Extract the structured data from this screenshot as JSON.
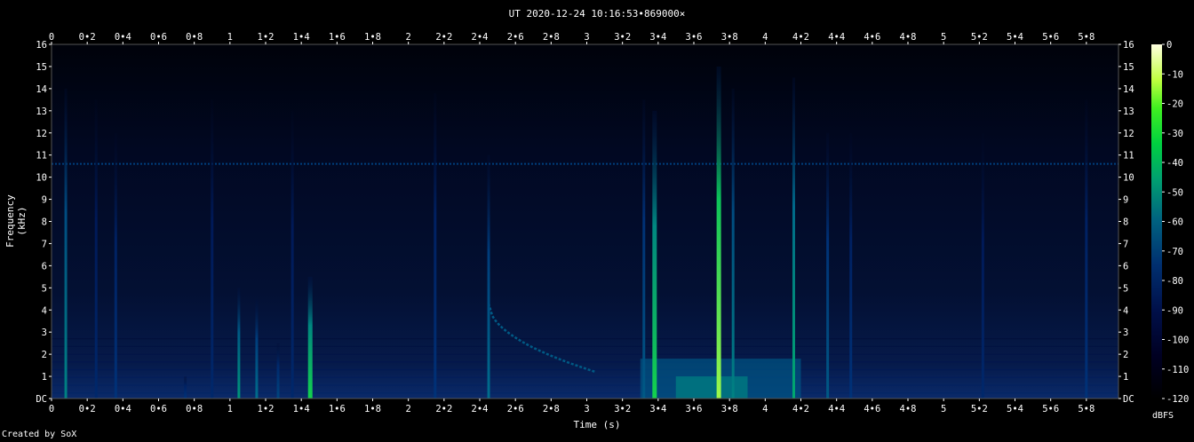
{
  "title": "UT 2020-12-24 10:16:53•869000×",
  "credit": "Created by SoX",
  "chart_data": {
    "type": "heatmap",
    "title": "UT 2020-12-24 10:16:53•869000×",
    "xlabel": "Time (s)",
    "ylabel": "Frequency (kHz)",
    "xlim": [
      0,
      5.98
    ],
    "ylim": [
      0,
      16
    ],
    "x_ticks": [
      "0",
      "0•2",
      "0•4",
      "0•6",
      "0•8",
      "1",
      "1•2",
      "1•4",
      "1•6",
      "1•8",
      "2",
      "2•2",
      "2•4",
      "2•6",
      "2•8",
      "3",
      "3•2",
      "3•4",
      "3•6",
      "3•8",
      "4",
      "4•2",
      "4•4",
      "4•6",
      "4•8",
      "5",
      "5•2",
      "5•4",
      "5•6",
      "5•8"
    ],
    "y_ticks": [
      "DC",
      "1",
      "2",
      "3",
      "4",
      "5",
      "6",
      "7",
      "8",
      "9",
      "10",
      "11",
      "12",
      "13",
      "14",
      "15",
      "16"
    ],
    "colorbar": {
      "label": "dBFS",
      "ticks": [
        "0",
        "-10",
        "-20",
        "-30",
        "-40",
        "-50",
        "-60",
        "-70",
        "-80",
        "-90",
        "-100",
        "-110",
        "-120"
      ],
      "range": [
        -120,
        0
      ]
    },
    "features": {
      "hum_line_khz": 10.6,
      "vertical_bursts": [
        {
          "t": 0.08,
          "top_khz": 14.0,
          "level": 0.55
        },
        {
          "t": 0.25,
          "top_khz": 13.5,
          "level": 0.3
        },
        {
          "t": 0.36,
          "top_khz": 12.0,
          "level": 0.35
        },
        {
          "t": 0.75,
          "top_khz": 1.0,
          "level": 0.35
        },
        {
          "t": 0.9,
          "top_khz": 13.5,
          "level": 0.3
        },
        {
          "t": 1.05,
          "top_khz": 5.0,
          "level": 0.6
        },
        {
          "t": 1.15,
          "top_khz": 4.5,
          "level": 0.5
        },
        {
          "t": 1.27,
          "top_khz": 2.5,
          "level": 0.4
        },
        {
          "t": 1.35,
          "top_khz": 13.0,
          "level": 0.3
        },
        {
          "t": 1.45,
          "top_khz": 5.5,
          "level": 0.75
        },
        {
          "t": 2.15,
          "top_khz": 13.8,
          "level": 0.35
        },
        {
          "t": 2.45,
          "top_khz": 11.0,
          "level": 0.5
        },
        {
          "t": 3.32,
          "top_khz": 13.5,
          "level": 0.45
        },
        {
          "t": 3.38,
          "top_khz": 13.0,
          "level": 0.75
        },
        {
          "t": 3.74,
          "top_khz": 15.0,
          "level": 0.95
        },
        {
          "t": 3.82,
          "top_khz": 14.0,
          "level": 0.55
        },
        {
          "t": 4.16,
          "top_khz": 14.5,
          "level": 0.65
        },
        {
          "t": 4.35,
          "top_khz": 12.0,
          "level": 0.45
        },
        {
          "t": 4.48,
          "top_khz": 12.0,
          "level": 0.35
        },
        {
          "t": 5.22,
          "top_khz": 12.0,
          "level": 0.3
        },
        {
          "t": 5.8,
          "top_khz": 13.5,
          "level": 0.35
        }
      ],
      "sweep": {
        "t_start": 2.45,
        "f_start_khz": 4.3,
        "t_end": 3.05,
        "f_end_khz": 1.2
      },
      "low_band_block": {
        "t_start": 3.3,
        "t_end": 4.2,
        "top_khz": 1.8,
        "level": 0.55
      }
    }
  }
}
